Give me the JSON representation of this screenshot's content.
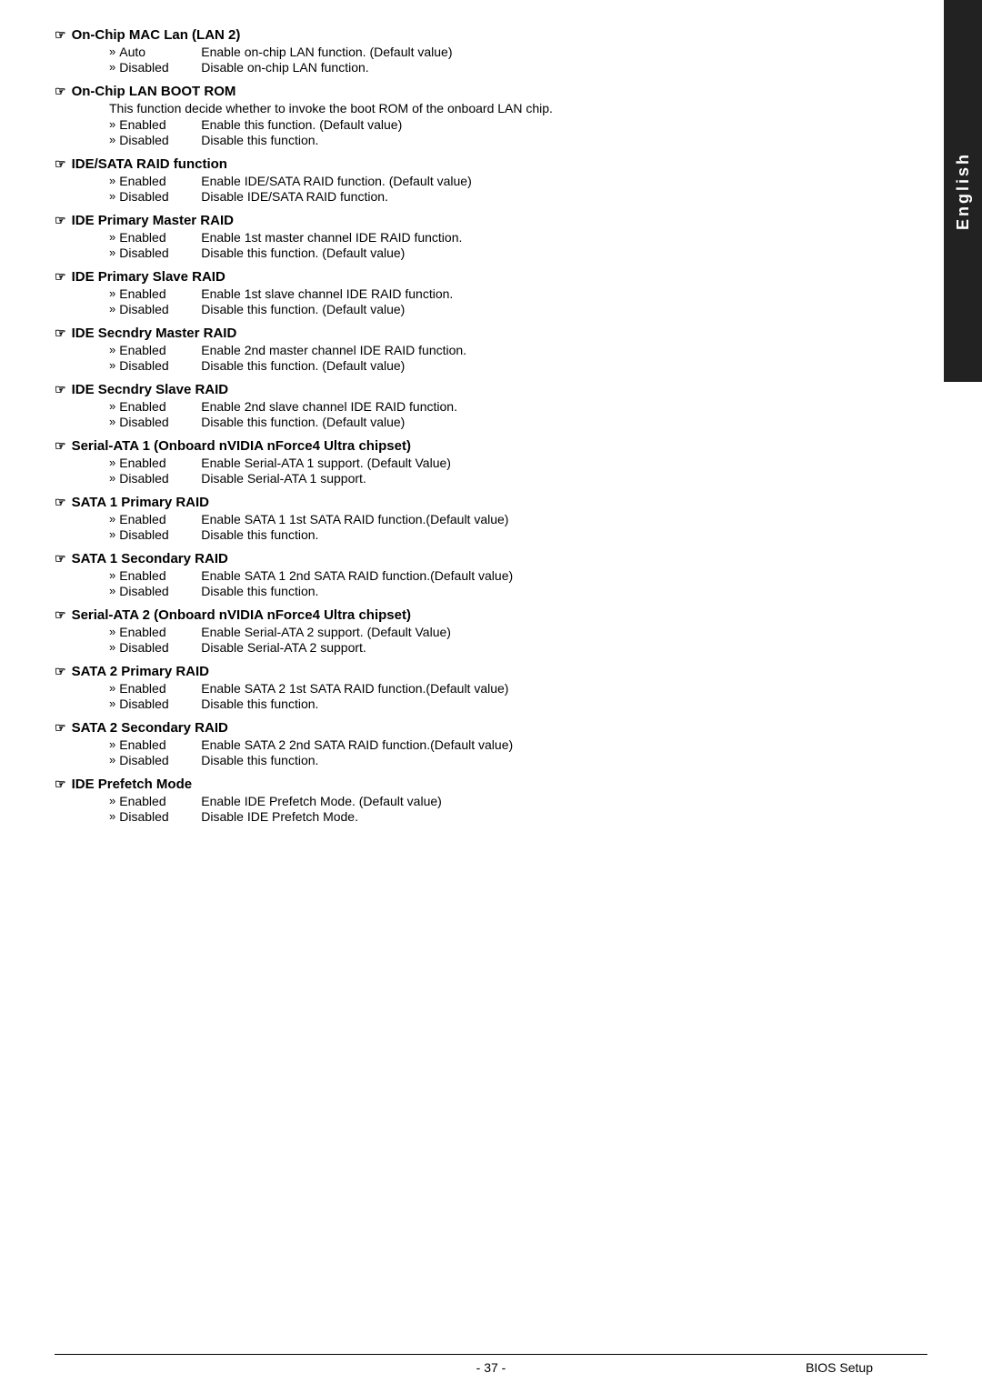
{
  "sidebar": {
    "label": "English"
  },
  "sections": [
    {
      "id": "on-chip-mac-lan",
      "title": "On-Chip MAC Lan (LAN 2)",
      "note": null,
      "options": [
        {
          "label": "Auto",
          "desc": "Enable on-chip LAN function. (Default value)"
        },
        {
          "label": "Disabled",
          "desc": "Disable on-chip LAN function."
        }
      ]
    },
    {
      "id": "on-chip-lan-boot-rom",
      "title": "On-Chip LAN BOOT ROM",
      "note": "This function decide whether to invoke the boot ROM of the onboard LAN chip.",
      "options": [
        {
          "label": "Enabled",
          "desc": "Enable this function. (Default value)"
        },
        {
          "label": "Disabled",
          "desc": "Disable this function."
        }
      ]
    },
    {
      "id": "ide-sata-raid",
      "title": "IDE/SATA RAID function",
      "note": null,
      "options": [
        {
          "label": "Enabled",
          "desc": "Enable IDE/SATA RAID function. (Default value)"
        },
        {
          "label": "Disabled",
          "desc": "Disable IDE/SATA RAID function."
        }
      ]
    },
    {
      "id": "ide-primary-master-raid",
      "title": "IDE Primary Master RAID",
      "note": null,
      "options": [
        {
          "label": "Enabled",
          "desc": "Enable 1st master channel IDE RAID function."
        },
        {
          "label": "Disabled",
          "desc": "Disable this function. (Default value)"
        }
      ]
    },
    {
      "id": "ide-primary-slave-raid",
      "title": "IDE Primary Slave RAID",
      "note": null,
      "options": [
        {
          "label": "Enabled",
          "desc": "Enable 1st slave channel IDE RAID function."
        },
        {
          "label": "Disabled",
          "desc": "Disable this function. (Default value)"
        }
      ]
    },
    {
      "id": "ide-secndry-master-raid",
      "title": "IDE Secndry Master RAID",
      "note": null,
      "options": [
        {
          "label": "Enabled",
          "desc": "Enable 2nd master channel IDE RAID function."
        },
        {
          "label": "Disabled",
          "desc": "Disable this function. (Default value)"
        }
      ]
    },
    {
      "id": "ide-secndry-slave-raid",
      "title": "IDE Secndry Slave RAID",
      "note": null,
      "options": [
        {
          "label": "Enabled",
          "desc": "Enable 2nd slave channel IDE RAID function."
        },
        {
          "label": "Disabled",
          "desc": "Disable this function. (Default value)"
        }
      ]
    },
    {
      "id": "serial-ata-1",
      "title": "Serial-ATA 1 (Onboard nVIDIA nForce4 Ultra chipset)",
      "note": null,
      "options": [
        {
          "label": "Enabled",
          "desc": "Enable Serial-ATA 1 support. (Default Value)"
        },
        {
          "label": "Disabled",
          "desc": "Disable Serial-ATA 1 support."
        }
      ]
    },
    {
      "id": "sata-1-primary-raid",
      "title": "SATA 1 Primary RAID",
      "note": null,
      "options": [
        {
          "label": "Enabled",
          "desc": "Enable SATA 1 1st SATA RAID function.(Default value)"
        },
        {
          "label": "Disabled",
          "desc": "Disable this function."
        }
      ]
    },
    {
      "id": "sata-1-secondary-raid",
      "title": "SATA 1 Secondary RAID",
      "note": null,
      "options": [
        {
          "label": "Enabled",
          "desc": "Enable SATA 1 2nd SATA RAID function.(Default value)"
        },
        {
          "label": "Disabled",
          "desc": "Disable this function."
        }
      ]
    },
    {
      "id": "serial-ata-2",
      "title": "Serial-ATA 2  (Onboard nVIDIA nForce4 Ultra chipset)",
      "note": null,
      "options": [
        {
          "label": "Enabled",
          "desc": "Enable Serial-ATA 2 support. (Default Value)"
        },
        {
          "label": "Disabled",
          "desc": "Disable Serial-ATA 2 support."
        }
      ]
    },
    {
      "id": "sata-2-primary-raid",
      "title": "SATA 2 Primary RAID",
      "note": null,
      "options": [
        {
          "label": "Enabled",
          "desc": "Enable SATA 2 1st SATA RAID function.(Default value)"
        },
        {
          "label": "Disabled",
          "desc": "Disable this function."
        }
      ]
    },
    {
      "id": "sata-2-secondary-raid",
      "title": "SATA 2 Secondary RAID",
      "note": null,
      "options": [
        {
          "label": "Enabled",
          "desc": "Enable SATA 2 2nd SATA RAID function.(Default value)"
        },
        {
          "label": "Disabled",
          "desc": "Disable this function."
        }
      ]
    },
    {
      "id": "ide-prefetch-mode",
      "title": "IDE Prefetch Mode",
      "note": null,
      "options": [
        {
          "label": "Enabled",
          "desc": "Enable IDE Prefetch Mode. (Default value)"
        },
        {
          "label": "Disabled",
          "desc": "Disable IDE Prefetch Mode."
        }
      ]
    }
  ],
  "footer": {
    "page": "- 37 -",
    "label": "BIOS Setup"
  }
}
